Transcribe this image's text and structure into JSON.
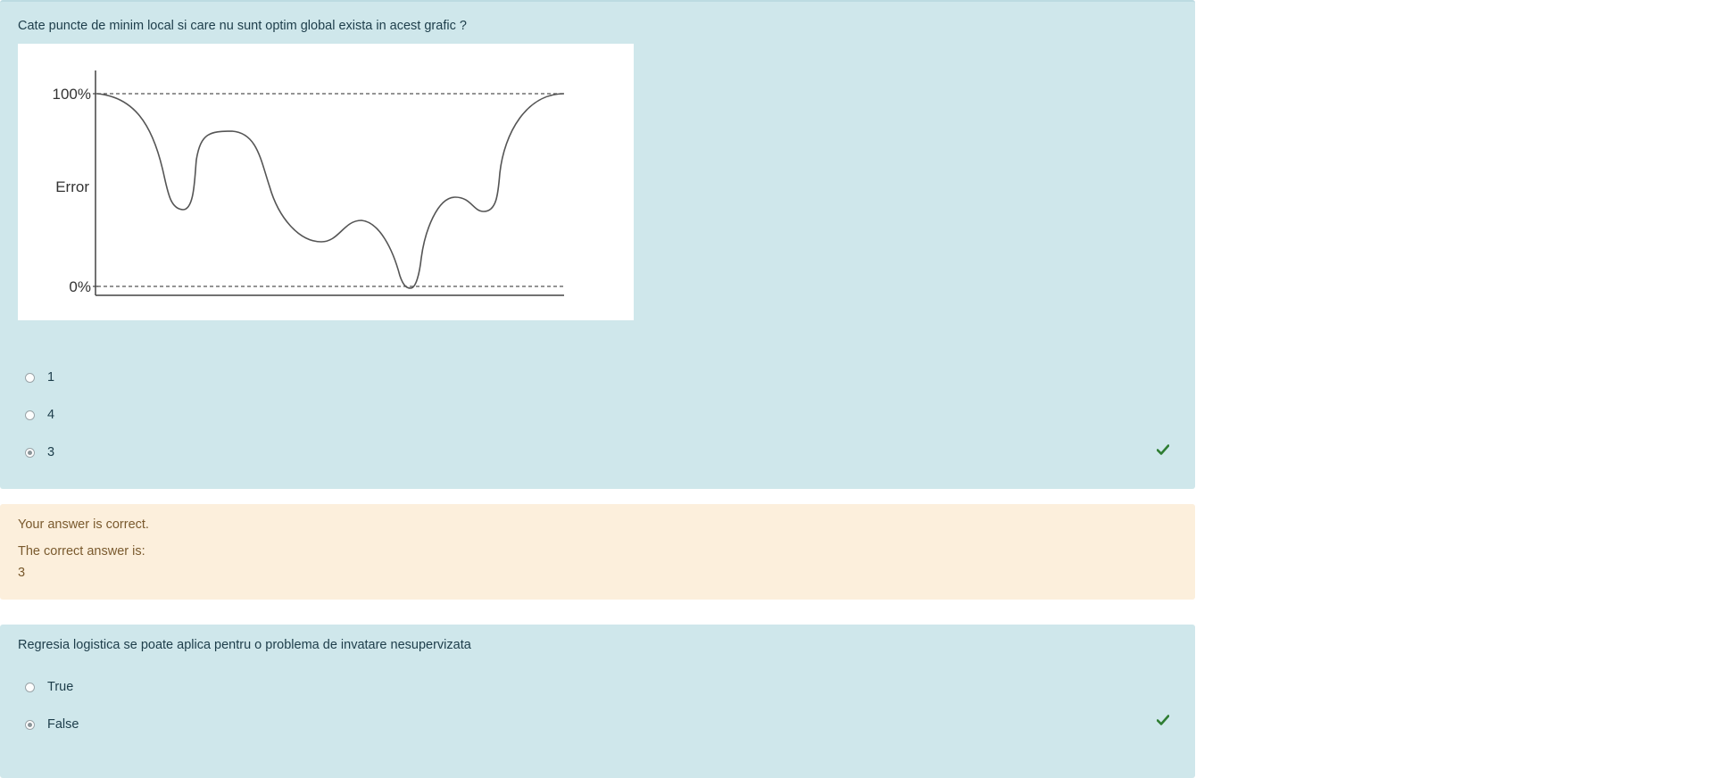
{
  "question1": {
    "text": "Cate puncte de minim local si care nu sunt optim global exista in acest grafic ?",
    "figure": {
      "y_top_label": "100%",
      "y_mid_label": "Error",
      "y_bottom_label": "0%"
    },
    "options": [
      {
        "label": "1",
        "selected": false
      },
      {
        "label": "4",
        "selected": false
      },
      {
        "label": "3",
        "selected": true
      }
    ],
    "status_icon": "check-icon"
  },
  "feedback": {
    "result": "Your answer is correct.",
    "correct_label": "The correct answer is:",
    "correct_value": "3"
  },
  "question2": {
    "text": "Regresia logistica se poate aplica pentru o problema de invatare nesupervizata",
    "options": [
      {
        "label": "True",
        "selected": false
      },
      {
        "label": "False",
        "selected": true
      }
    ],
    "status_icon": "check-icon"
  },
  "colors": {
    "question_bg": "#cfe7eb",
    "feedback_bg": "#fcefdc",
    "check_green": "#2e7d32"
  }
}
